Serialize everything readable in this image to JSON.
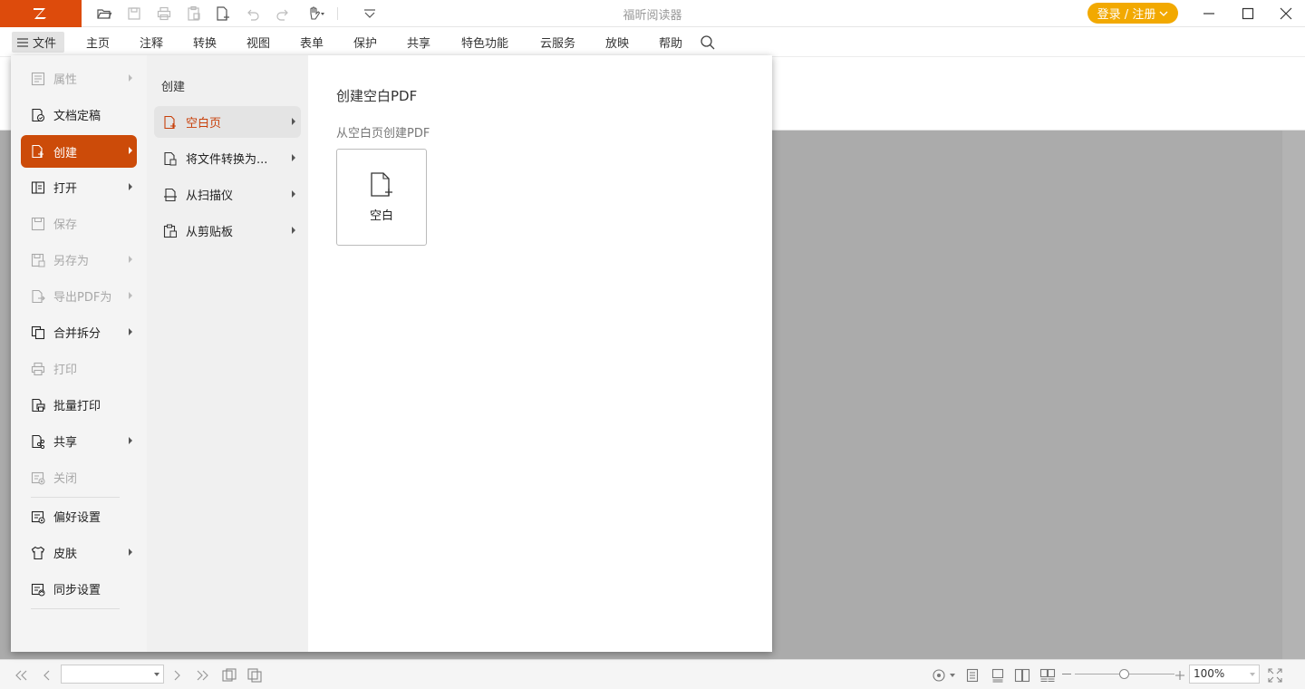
{
  "app": {
    "title": "福昕阅读器",
    "accent": "#dd4b0c",
    "login_label": "登录 / 注册"
  },
  "menubar": {
    "file_label": "文件",
    "tabs": [
      "主页",
      "注释",
      "转换",
      "视图",
      "表单",
      "保护",
      "共享",
      "特色功能",
      "云服务",
      "放映",
      "帮助"
    ]
  },
  "file_menu": {
    "items": [
      {
        "label": "属性",
        "enabled": false,
        "submenu": true,
        "icon": "properties-icon"
      },
      {
        "label": "文档定稿",
        "enabled": true,
        "submenu": false,
        "icon": "finalize-icon"
      },
      {
        "label": "创建",
        "enabled": true,
        "submenu": true,
        "active": true,
        "icon": "create-icon"
      },
      {
        "label": "打开",
        "enabled": true,
        "submenu": true,
        "icon": "open-icon"
      },
      {
        "label": "保存",
        "enabled": false,
        "submenu": false,
        "icon": "save-icon"
      },
      {
        "label": "另存为",
        "enabled": false,
        "submenu": true,
        "icon": "save-as-icon"
      },
      {
        "label": "导出PDF为",
        "enabled": false,
        "submenu": true,
        "icon": "export-icon"
      },
      {
        "label": "合并拆分",
        "enabled": true,
        "submenu": true,
        "icon": "merge-split-icon"
      },
      {
        "label": "打印",
        "enabled": false,
        "submenu": false,
        "icon": "print-icon"
      },
      {
        "label": "批量打印",
        "enabled": true,
        "submenu": false,
        "icon": "batch-print-icon"
      },
      {
        "label": "共享",
        "enabled": true,
        "submenu": true,
        "icon": "share-icon"
      },
      {
        "label": "关闭",
        "enabled": false,
        "submenu": false,
        "icon": "close-doc-icon"
      },
      {
        "label": "偏好设置",
        "enabled": true,
        "submenu": false,
        "icon": "preferences-icon"
      },
      {
        "label": "皮肤",
        "enabled": true,
        "submenu": true,
        "icon": "skin-icon"
      },
      {
        "label": "同步设置",
        "enabled": true,
        "submenu": false,
        "icon": "sync-settings-icon"
      }
    ]
  },
  "create_submenu": {
    "heading": "创建",
    "items": [
      {
        "label": "空白页",
        "active": true,
        "icon": "blank-page-icon"
      },
      {
        "label": "将文件转换为...",
        "active": false,
        "icon": "convert-file-icon"
      },
      {
        "label": "从扫描仪",
        "active": false,
        "icon": "scanner-icon"
      },
      {
        "label": "从剪贴板",
        "active": false,
        "icon": "clipboard-icon"
      }
    ]
  },
  "detail": {
    "title": "创建空白PDF",
    "subtitle": "从空白页创建PDF",
    "card_label": "空白"
  },
  "statusbar": {
    "zoom": "100%",
    "zoom_level": 0.5
  }
}
